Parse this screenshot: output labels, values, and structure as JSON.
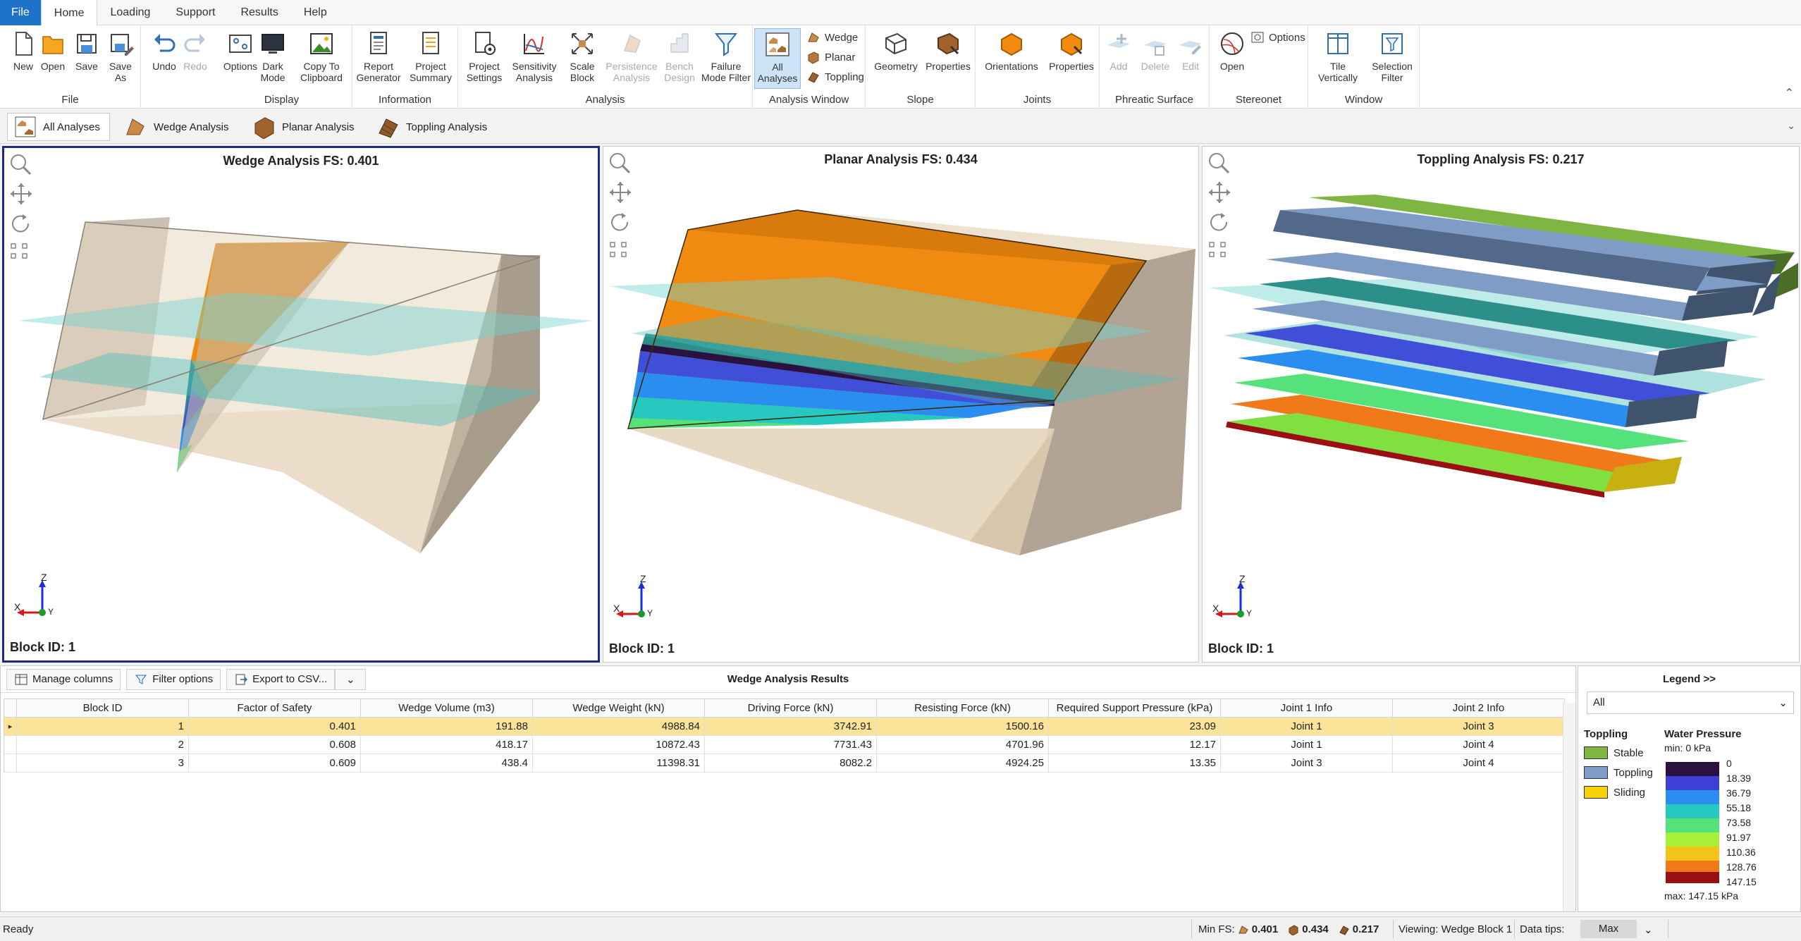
{
  "menu": {
    "file": "File",
    "tabs": [
      "Home",
      "Loading",
      "Support",
      "Results",
      "Help"
    ]
  },
  "ribbon": {
    "groups": {
      "file": "File",
      "display": "Display",
      "information": "Information",
      "analysis": "Analysis",
      "analysis_window": "Analysis Window",
      "slope": "Slope",
      "joints": "Joints",
      "phreatic": "Phreatic Surface",
      "stereonet": "Stereonet",
      "window": "Window"
    },
    "buttons": {
      "new": "New",
      "open": "Open",
      "save": "Save",
      "save_as": "Save As",
      "undo": "Undo",
      "redo": "Redo",
      "options": "Options",
      "dark_mode": "Dark Mode",
      "copy_clipboard": "Copy To Clipboard",
      "report_generator": "Report Generator",
      "project_summary": "Project Summary",
      "project_settings": "Project Settings",
      "sensitivity": "Sensitivity Analysis",
      "scale_block": "Scale Block",
      "persistence": "Persistence Analysis",
      "bench_design": "Bench Design",
      "failure_filter": "Failure Mode Filter",
      "all_analyses": "All Analyses",
      "wedge": "Wedge",
      "planar": "Planar",
      "toppling": "Toppling",
      "geometry": "Geometry",
      "properties": "Properties",
      "orientations": "Orientations",
      "joint_properties": "Properties",
      "add": "Add",
      "delete": "Delete",
      "edit": "Edit",
      "stereo_open": "Open",
      "stereo_options": "Options",
      "tile": "Tile Vertically",
      "selection_filter": "Selection Filter"
    }
  },
  "tabs": [
    "All Analyses",
    "Wedge Analysis",
    "Planar Analysis",
    "Toppling Analysis"
  ],
  "viewports": [
    {
      "title": "Wedge Analysis FS: 0.401",
      "block": "Block ID: 1"
    },
    {
      "title": "Planar Analysis FS: 0.434",
      "block": "Block ID: 1"
    },
    {
      "title": "Toppling Analysis FS: 0.217",
      "block": "Block ID: 1"
    }
  ],
  "axes": {
    "z": "Z",
    "x": "X",
    "y": "Y"
  },
  "results": {
    "title": "Wedge Analysis Results",
    "manage_columns": "Manage columns",
    "filter_options": "Filter options",
    "export_csv": "Export to CSV...",
    "columns": [
      "Block ID",
      "Factor of Safety",
      "Wedge Volume (m3)",
      "Wedge Weight (kN)",
      "Driving Force (kN)",
      "Resisting Force (kN)",
      "Required Support Pressure (kPa)",
      "Joint 1 Info",
      "Joint 2 Info"
    ],
    "rows": [
      [
        "1",
        "0.401",
        "191.88",
        "4988.84",
        "3742.91",
        "1500.16",
        "23.09",
        "Joint 1",
        "Joint 3"
      ],
      [
        "2",
        "0.608",
        "418.17",
        "10872.43",
        "7731.43",
        "4701.96",
        "12.17",
        "Joint 1",
        "Joint 4"
      ],
      [
        "3",
        "0.609",
        "438.4",
        "11398.31",
        "8082.2",
        "4924.25",
        "13.35",
        "Joint 3",
        "Joint 4"
      ]
    ]
  },
  "legend": {
    "title": "Legend >>",
    "filter": "All",
    "toppling_heading": "Toppling",
    "toppling_items": [
      {
        "label": "Stable",
        "color": "#7fb643"
      },
      {
        "label": "Toppling",
        "color": "#7f9cc6"
      },
      {
        "label": "Sliding",
        "color": "#f5d20a"
      }
    ],
    "water_heading": "Water Pressure",
    "min": "min: 0 kPa",
    "max": "max: 147.15 kPa",
    "values": [
      "0",
      "18.39",
      "36.79",
      "55.18",
      "73.58",
      "91.97",
      "110.36",
      "128.76",
      "147.15"
    ],
    "colors": [
      "#2a1240",
      "#3f3fd8",
      "#2a8ef0",
      "#27c8c0",
      "#55e27a",
      "#a6f03a",
      "#f5c21a",
      "#f07a1a",
      "#9a1010"
    ]
  },
  "status": {
    "ready": "Ready",
    "min_fs": "Min FS:",
    "fs_wedge": "0.401",
    "fs_planar": "0.434",
    "fs_toppling": "0.217",
    "viewing": "Viewing: Wedge Block 1",
    "data_tips": "Data tips:",
    "data_tips_value": "Max"
  }
}
